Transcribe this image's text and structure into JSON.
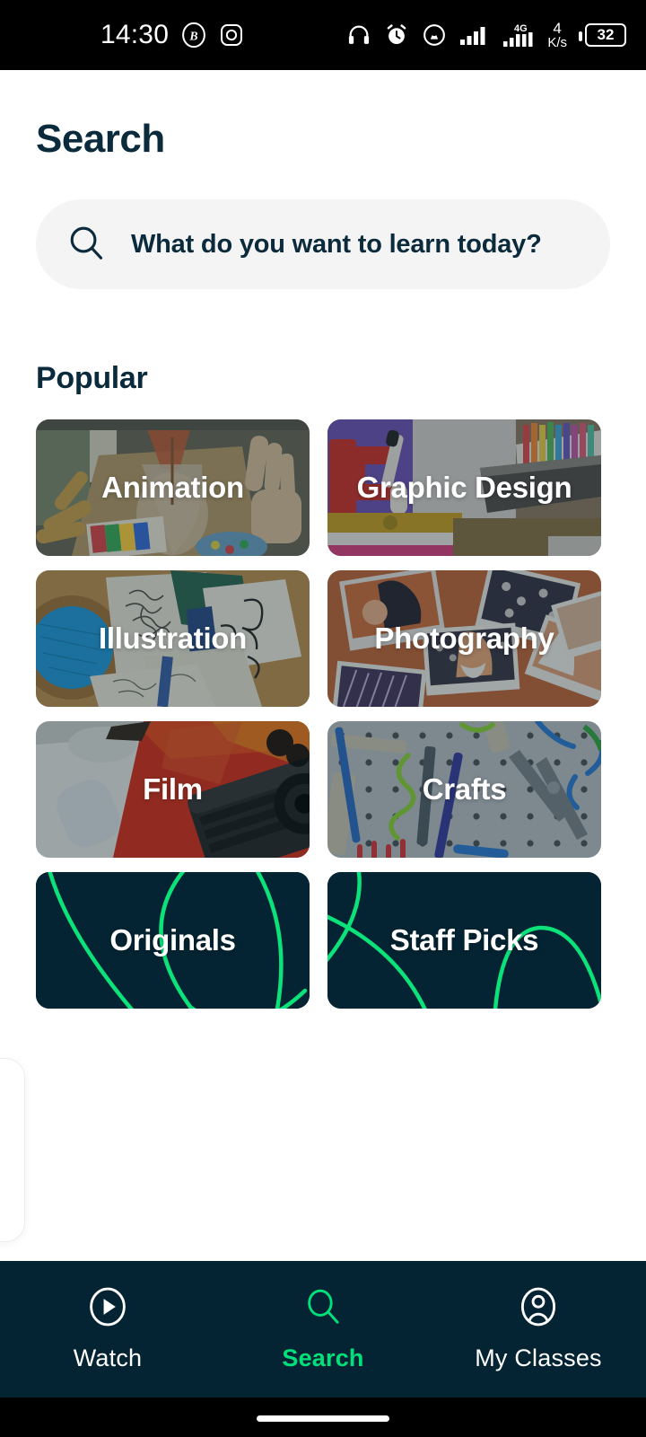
{
  "statusbar": {
    "time": "14:30",
    "left_icons": [
      "bitcoin-circle-icon",
      "instagram-icon"
    ],
    "right_icons": [
      "headphones-icon",
      "alarm-clock-icon",
      "hotspot-icon",
      "signal-bars-icon",
      "4g-signal-icon"
    ],
    "network_speed_value": "4",
    "network_speed_unit": "K/s",
    "battery_percent": "32"
  },
  "header": {
    "title": "Search"
  },
  "search": {
    "placeholder": "What do you want to learn today?",
    "value": "",
    "icon": "search-icon"
  },
  "popular": {
    "section_title": "Popular",
    "categories": [
      {
        "label": "Animation",
        "style": "photo",
        "image": "art supplies with wooden mannequin hand",
        "accent": "#4A5544"
      },
      {
        "label": "Graphic Design",
        "style": "photo",
        "image": "desk with red clamp, markers and colored pencils",
        "accent": "#6B4A46"
      },
      {
        "label": "Illustration",
        "style": "photo",
        "image": "open sketchbooks with line drawings on cork",
        "accent": "#3E5A6B"
      },
      {
        "label": "Photography",
        "style": "photo",
        "image": "scattered instant photos of a woman",
        "accent": "#B0613A"
      },
      {
        "label": "Film",
        "style": "photo",
        "image": "camera lens on red and white background",
        "accent": "#8E3A2A"
      },
      {
        "label": "Crafts",
        "style": "photo",
        "image": "pegboard with tools and colored rods",
        "accent": "#8A949B"
      },
      {
        "label": "Originals",
        "style": "brand",
        "image": "green curves on dark navy",
        "accent": "#042433"
      },
      {
        "label": "Staff Picks",
        "style": "brand",
        "image": "green curves on dark navy",
        "accent": "#042433"
      }
    ]
  },
  "bottom_nav": {
    "active_index": 1,
    "accent_color": "#00E07B",
    "background_color": "#042433",
    "items": [
      {
        "label": "Watch",
        "icon": "play-circle-icon"
      },
      {
        "label": "Search",
        "icon": "search-icon"
      },
      {
        "label": "My Classes",
        "icon": "user-circle-icon"
      }
    ]
  },
  "colors": {
    "brand_navy": "#042433",
    "text_navy": "#0B2B3C",
    "accent_green": "#00E07B",
    "search_field_bg": "#F4F4F4",
    "page_bg": "#FFFFFF"
  }
}
